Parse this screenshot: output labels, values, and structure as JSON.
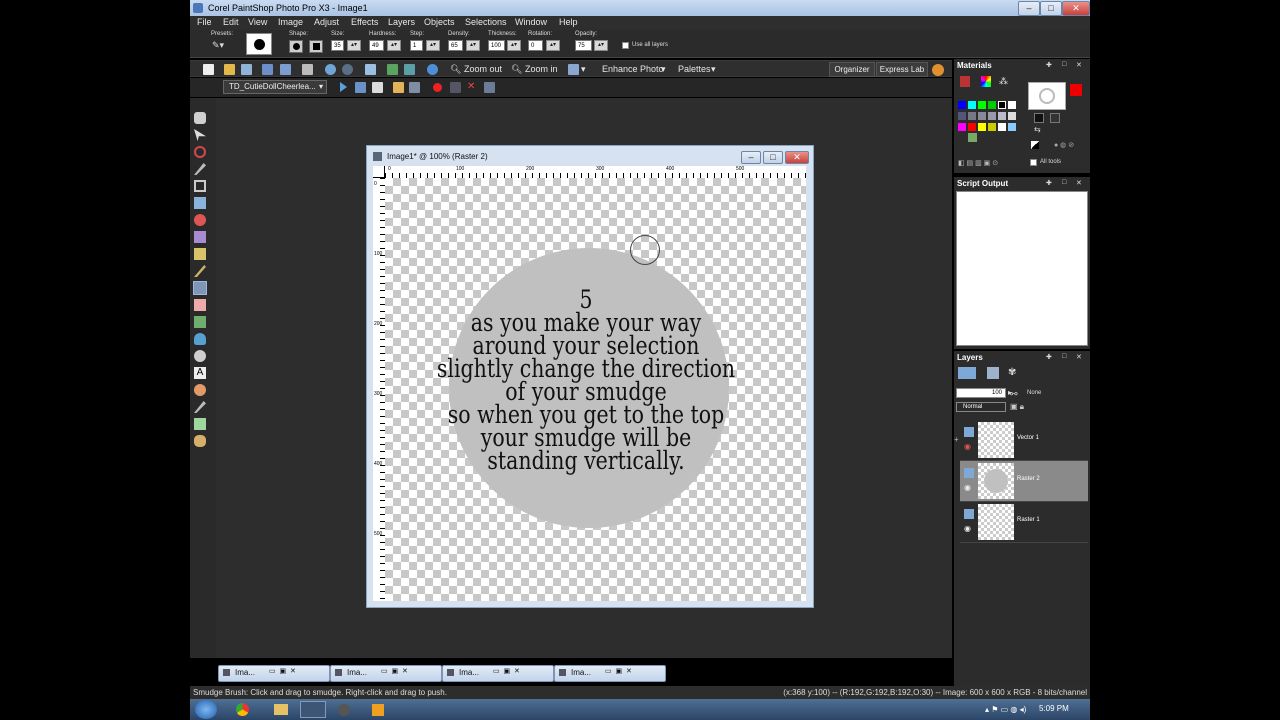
{
  "window": {
    "title": "Corel PaintShop Photo Pro X3 - Image1"
  },
  "menu": [
    "File",
    "Edit",
    "View",
    "Image",
    "Adjust",
    "Effects",
    "Layers",
    "Objects",
    "Selections",
    "Window",
    "Help"
  ],
  "tool_options": {
    "presets_label": "Presets:",
    "shape_label": "Shape:",
    "size": {
      "label": "Size:",
      "value": "35"
    },
    "hardness": {
      "label": "Hardness:",
      "value": "49"
    },
    "step": {
      "label": "Step:",
      "value": "1"
    },
    "density": {
      "label": "Density:",
      "value": "65"
    },
    "thickness": {
      "label": "Thickness:",
      "value": "100"
    },
    "rotation": {
      "label": "Rotation:",
      "value": "0"
    },
    "opacity": {
      "label": "Opacity:",
      "value": "75"
    },
    "use_all_layers": "Use all layers"
  },
  "standard_toolbar": {
    "zoom_out": "Zoom out",
    "zoom_in": "Zoom in",
    "enhance_photo": "Enhance Photo",
    "palettes": "Palettes",
    "organizer": "Organizer",
    "express_lab": "Express Lab"
  },
  "script_toolbar": {
    "script_name": "TD_CutieDollCheerlea..."
  },
  "image_window": {
    "title": "Image1* @ 100% (Raster 2)",
    "ruler_h": [
      "0",
      "100",
      "200",
      "300",
      "400",
      "500"
    ],
    "ruler_v": [
      "0",
      "100",
      "200",
      "300",
      "400",
      "500"
    ],
    "canvas_text": [
      "5",
      "as you make your way",
      "around your selection",
      "slightly change the direction",
      "of your smudge",
      "so when you get to the top",
      "your smudge will be",
      "standing vertically."
    ]
  },
  "minimized_windows": [
    "Ima...",
    "Ima...",
    "Ima...",
    "Ima..."
  ],
  "status": {
    "left": "Smudge Brush: Click and drag to smudge. Right-click and drag to push.",
    "right": "(x:368 y:100) -- (R:192,G:192,B:192,O:30) -- Image: 600 x 600 x RGB - 8 bits/channel"
  },
  "materials": {
    "title": "Materials",
    "all_tools": "All tools"
  },
  "script_output": {
    "title": "Script Output"
  },
  "layers": {
    "title": "Layers",
    "opacity": "100",
    "mask": "None",
    "blend": "Normal",
    "items": [
      {
        "name": "Vector 1"
      },
      {
        "name": "Raster 2"
      },
      {
        "name": "Raster 1"
      }
    ]
  },
  "taskbar": {
    "time": "5:09 PM"
  },
  "colors": {
    "accent": "#7e96b8",
    "titlebar": "#c9dbf1",
    "close": "#c9413b"
  }
}
